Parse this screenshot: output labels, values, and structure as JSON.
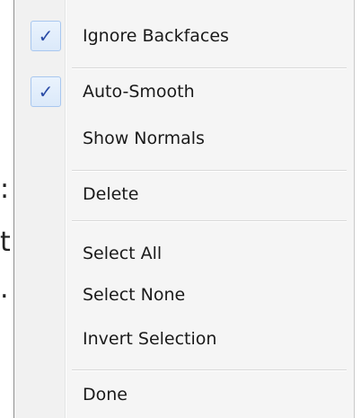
{
  "background": {
    "glyphs": [
      ":",
      "t",
      "."
    ]
  },
  "menu": {
    "items": [
      {
        "label": "Ignore Backfaces",
        "checked": true
      },
      {
        "label": "Auto-Smooth",
        "checked": true
      },
      {
        "label": "Show Normals",
        "checked": false
      },
      {
        "label": "Delete",
        "checked": false
      },
      {
        "label": "Select All",
        "checked": false
      },
      {
        "label": "Select None",
        "checked": false
      },
      {
        "label": "Invert Selection",
        "checked": false
      },
      {
        "label": "Done",
        "checked": false
      }
    ],
    "check_glyph": "✓"
  },
  "colors": {
    "check": "#2a4ba6",
    "check_bg": "#dbe9fa",
    "menu_bg": "#f5f5f5"
  }
}
